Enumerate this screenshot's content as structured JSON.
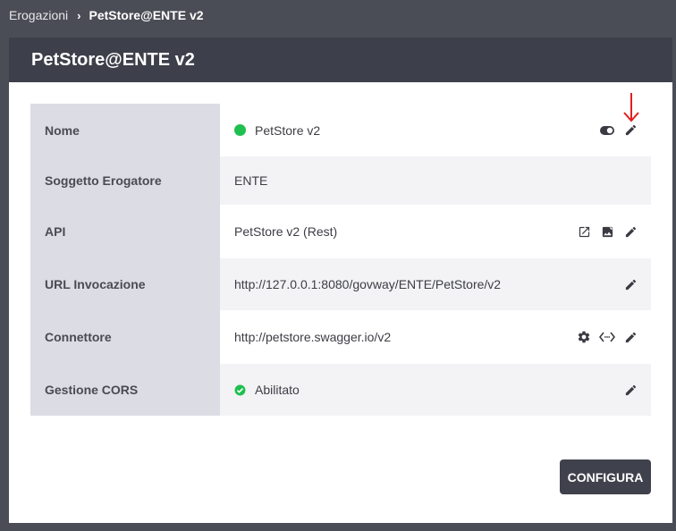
{
  "breadcrumb": {
    "parent": "Erogazioni",
    "separator": "›",
    "current": "PetStore@ENTE v2"
  },
  "panel": {
    "title": "PetStore@ENTE v2"
  },
  "rows": [
    {
      "label": "Nome",
      "value": "PetStore v2",
      "status": "active",
      "actions": [
        "toggle-icon",
        "edit-icon"
      ]
    },
    {
      "label": "Soggetto Erogatore",
      "value": "ENTE",
      "actions": []
    },
    {
      "label": "API",
      "value": "PetStore v2 (Rest)",
      "actions": [
        "open-external-icon",
        "image-icon",
        "edit-icon"
      ]
    },
    {
      "label": "URL Invocazione",
      "value": "http://127.0.0.1:8080/govway/ENTE/PetStore/v2",
      "actions": [
        "edit-icon"
      ]
    },
    {
      "label": "Connettore",
      "value": "http://petstore.swagger.io/v2",
      "actions": [
        "gear-icon",
        "code-icon",
        "edit-icon"
      ]
    },
    {
      "label": "Gestione CORS",
      "value": "Abilitato",
      "status": "enabled",
      "actions": [
        "edit-icon"
      ]
    }
  ],
  "buttons": {
    "configura": "CONFIGURA"
  },
  "colors": {
    "status_green": "#1fbf50",
    "annotation_red": "#e0201e",
    "header_bg": "#3d3f4a"
  }
}
